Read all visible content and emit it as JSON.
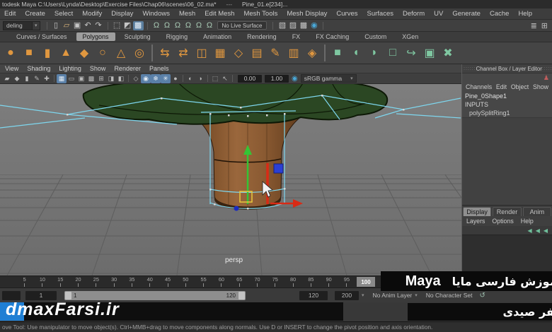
{
  "title_bar": {
    "title": "todesk Maya C:\\Users\\Lynda\\Desktop\\Exercise Files\\Chap06\\scenes\\06_02.ma*",
    "separator": "---",
    "suffix": "Pine_01.e[234]..."
  },
  "menu_bar": {
    "items": [
      "Edit",
      "Create",
      "Select",
      "Modify",
      "Display",
      "Windows",
      "Mesh",
      "Edit Mesh",
      "Mesh Tools",
      "Mesh Display",
      "Curves",
      "Surfaces",
      "Deform",
      "UV",
      "Generate",
      "Cache",
      "Help"
    ]
  },
  "status_line": {
    "mode": "deling",
    "no_live_surface": "No Live Surface",
    "icons_left": [
      {
        "name": "divider",
        "cls": "div",
        "glyph": ""
      },
      {
        "name": "new-scene-icon",
        "glyph": "▯"
      },
      {
        "name": "open-scene-icon",
        "glyph": "▱",
        "cls": "tan"
      },
      {
        "name": "save-scene-icon",
        "glyph": "▣"
      },
      {
        "name": "undo-icon",
        "glyph": "↶"
      },
      {
        "name": "redo-icon",
        "glyph": "↷"
      },
      {
        "name": "divider",
        "cls": "div",
        "glyph": ""
      },
      {
        "name": "select-hierarchy-icon",
        "glyph": "⬚"
      },
      {
        "name": "select-object-icon",
        "glyph": "◩"
      },
      {
        "name": "select-component-icon",
        "glyph": "▩",
        "cls": "lit"
      },
      {
        "name": "divider",
        "cls": "div",
        "glyph": ""
      },
      {
        "name": "snap-grid-icon",
        "glyph": "Ω",
        "cls": "grn"
      },
      {
        "name": "snap-curve-icon",
        "glyph": "Ω",
        "cls": "grn"
      },
      {
        "name": "snap-point-icon",
        "glyph": "Ω",
        "cls": "grn"
      },
      {
        "name": "snap-projected-center-icon",
        "glyph": "Ω",
        "cls": "grn"
      },
      {
        "name": "snap-view-plane-icon",
        "glyph": "Ω",
        "cls": "grn"
      },
      {
        "name": "make-live-icon",
        "glyph": "Ω",
        "cls": "grn"
      }
    ],
    "icons_right": [
      {
        "name": "divider",
        "cls": "div",
        "glyph": ""
      },
      {
        "name": "input-connections-icon",
        "glyph": "▧"
      },
      {
        "name": "output-connections-icon",
        "glyph": "▨"
      },
      {
        "name": "history-icon",
        "glyph": "▩"
      },
      {
        "name": "render-icon",
        "glyph": "◉",
        "cls": "blu"
      },
      {
        "name": "divider",
        "cls": "div",
        "glyph": ""
      }
    ],
    "far_right_icons": [
      {
        "name": "sidebar-toggle-icon",
        "glyph": "≣"
      },
      {
        "name": "workspace-icon",
        "glyph": "⊞"
      }
    ]
  },
  "shelf": {
    "tabs": [
      {
        "label": "Curves / Surfaces"
      },
      {
        "label": "Polygons",
        "cls": "active"
      },
      {
        "label": "Sculpting"
      },
      {
        "label": "Rigging"
      },
      {
        "label": "Animation"
      },
      {
        "label": "Rendering"
      },
      {
        "label": "FX"
      },
      {
        "label": "FX Caching"
      },
      {
        "label": "Custom"
      },
      {
        "label": "XGen"
      }
    ],
    "icons": [
      {
        "name": "poly-sphere-icon",
        "glyph": "●",
        "cls": "or"
      },
      {
        "name": "poly-cube-icon",
        "glyph": "■",
        "cls": "or"
      },
      {
        "name": "poly-cylinder-icon",
        "glyph": "▮",
        "cls": "or"
      },
      {
        "name": "poly-cone-icon",
        "glyph": "▲",
        "cls": "or"
      },
      {
        "name": "poly-plane-icon",
        "glyph": "◆",
        "cls": "or"
      },
      {
        "name": "poly-torus-icon",
        "glyph": "○",
        "cls": "or"
      },
      {
        "name": "poly-pyramid-icon",
        "glyph": "△",
        "cls": "or"
      },
      {
        "name": "poly-pipe-icon",
        "glyph": "◎",
        "cls": "or"
      },
      {
        "name": "divider",
        "cls": "div",
        "glyph": ""
      },
      {
        "name": "combine-icon",
        "glyph": "⇆",
        "cls": "or"
      },
      {
        "name": "separate-icon",
        "glyph": "⇄",
        "cls": "or"
      },
      {
        "name": "mirror-icon",
        "glyph": "◫",
        "cls": "or"
      },
      {
        "name": "smooth-icon",
        "glyph": "▦",
        "cls": "or"
      },
      {
        "name": "subdiv-proxy-icon",
        "glyph": "◇",
        "cls": "or"
      },
      {
        "name": "reduce-icon",
        "glyph": "▤",
        "cls": "or"
      },
      {
        "name": "sculpt-icon",
        "glyph": "✎",
        "cls": "or"
      },
      {
        "name": "booleans-icon",
        "glyph": "▥",
        "cls": "or"
      },
      {
        "name": "triangulate-icon",
        "glyph": "◈",
        "cls": "or"
      },
      {
        "name": "divider",
        "cls": "div",
        "glyph": ""
      },
      {
        "name": "extrude-icon",
        "glyph": "■",
        "cls": "tl"
      },
      {
        "name": "bevel-icon",
        "glyph": "◖",
        "cls": "tl"
      },
      {
        "name": "bridge-icon",
        "glyph": "◗",
        "cls": "tl"
      },
      {
        "name": "add-divisions-icon",
        "glyph": "□",
        "cls": "tl"
      },
      {
        "name": "wedge-icon",
        "glyph": "↪",
        "cls": "tl"
      },
      {
        "name": "multi-cut-icon",
        "glyph": "▣",
        "cls": "tl"
      },
      {
        "name": "target-weld-icon",
        "glyph": "✖",
        "cls": "tl"
      }
    ]
  },
  "panel_menu": {
    "items": [
      "View",
      "Shading",
      "Lighting",
      "Show",
      "Renderer",
      "Panels"
    ]
  },
  "viewport_toolbar": {
    "icons": [
      {
        "name": "camera-icon",
        "glyph": "▰"
      },
      {
        "name": "camera-attributes-icon",
        "glyph": "◆"
      },
      {
        "name": "bookmark-icon",
        "glyph": "▮"
      },
      {
        "name": "image-plane-icon",
        "glyph": "✎"
      },
      {
        "name": "pan-zoom-icon",
        "glyph": "✚"
      },
      {
        "name": "divider",
        "cls": "div",
        "glyph": ""
      },
      {
        "name": "wireframe-icon",
        "glyph": "▦",
        "cls": "lit"
      },
      {
        "name": "shaded-icon",
        "glyph": "▭"
      },
      {
        "name": "textured-icon",
        "glyph": "▣"
      },
      {
        "name": "use-all-lights-icon",
        "glyph": "▩"
      },
      {
        "name": "shadows-icon",
        "glyph": "⊞"
      },
      {
        "name": "ambient-occlusion-icon",
        "glyph": "◨"
      },
      {
        "name": "motion-blur-icon",
        "glyph": "◧"
      },
      {
        "name": "divider",
        "cls": "div",
        "glyph": ""
      },
      {
        "name": "isolate-select-icon",
        "glyph": "◇"
      },
      {
        "name": "xray-icon",
        "glyph": "◉",
        "cls": "lit"
      },
      {
        "name": "wireframe-on-shaded-icon",
        "glyph": "❄",
        "cls": "lit"
      },
      {
        "name": "default-material-icon",
        "glyph": "✳",
        "cls": "lit"
      },
      {
        "name": "lighting-icon",
        "glyph": "●"
      },
      {
        "name": "divider",
        "cls": "div",
        "glyph": ""
      },
      {
        "name": "gate-mask-icon",
        "glyph": "◐"
      },
      {
        "name": "field-chart-icon",
        "glyph": "◑"
      },
      {
        "name": "divider",
        "cls": "div",
        "glyph": ""
      },
      {
        "name": "select-highlight-icon",
        "glyph": "⬚"
      },
      {
        "name": "plugin-shape-icon",
        "glyph": "↖"
      },
      {
        "name": "divider",
        "cls": "div",
        "glyph": ""
      }
    ],
    "exposure": "0.00",
    "gamma": "1.00",
    "view_transform": "sRGB gamma"
  },
  "viewport": {
    "camera_label": "persp"
  },
  "channel_box": {
    "header": "Channel Box / Layer Editor",
    "grip": "::::::",
    "menus": [
      "Channels",
      "Edit",
      "Object",
      "Show"
    ],
    "object_name": "Pine_0Shape1",
    "inputs_label": "INPUTS",
    "input_node": "polySplitRing1"
  },
  "layer_editor": {
    "tabs": [
      {
        "label": "Display",
        "cls": "active"
      },
      {
        "label": "Render"
      },
      {
        "label": "Anim"
      }
    ],
    "menus": [
      "Layers",
      "Options",
      "Help"
    ],
    "icons": [
      {
        "name": "layer-move-up-icon",
        "glyph": "◀"
      },
      {
        "name": "layer-move-down-icon",
        "glyph": "◀"
      },
      {
        "name": "layer-empty-icon",
        "glyph": "◀"
      }
    ]
  },
  "timeline": {
    "ticks": [
      {
        "n": "5"
      },
      {
        "n": "10"
      },
      {
        "n": "15"
      },
      {
        "n": "20"
      },
      {
        "n": "25"
      },
      {
        "n": "30"
      },
      {
        "n": "35"
      },
      {
        "n": "40"
      },
      {
        "n": "45"
      },
      {
        "n": "50"
      },
      {
        "n": "55"
      },
      {
        "n": "60"
      },
      {
        "n": "65"
      },
      {
        "n": "70"
      },
      {
        "n": "75"
      },
      {
        "n": "80"
      },
      {
        "n": "85"
      },
      {
        "n": "90"
      },
      {
        "n": "95"
      },
      {
        "n": "100"
      }
    ],
    "current_frame": "100"
  },
  "range_slider": {
    "anim_start": "",
    "playback_start": "1",
    "range_start_label": "1",
    "range_end_label": "120",
    "playback_end": "120",
    "anim_end": "200",
    "anim_layer": "No Anim Layer",
    "character_set": "No Character Set"
  },
  "overlays": {
    "title_fa": "آموزش فارسی مایا",
    "title_en": "Maya",
    "author_fa": "جعفر صیدی",
    "watermark": "dmaxFarsi.ir"
  },
  "help_line": {
    "text": "ove Tool: Use manipulator to move object(s). Ctrl+MMB+drag to move components along normals. Use D or INSERT to change the pivot position and axis orientation."
  },
  "colors": {
    "accent_orange": "#e0973f",
    "accent_teal": "#7fc7a1",
    "wireframe_cyan": "#7ed7ef",
    "manip_green": "#35c435",
    "manip_red": "#d92a15",
    "manip_blue": "#2b3fd4",
    "watermark_blue": "#1f7fd4"
  }
}
